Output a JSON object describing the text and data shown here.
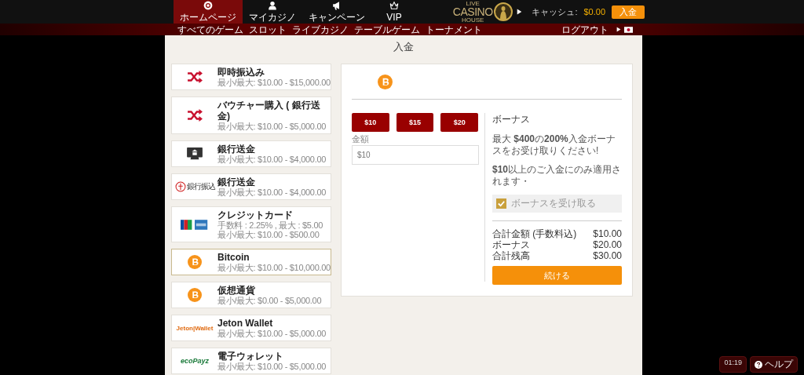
{
  "nav": {
    "tabs": [
      {
        "label": "ホームページ",
        "selected": true
      },
      {
        "label": "マイカジノ",
        "selected": false
      },
      {
        "label": "キャンペーン",
        "selected": false
      },
      {
        "label": "VIP",
        "selected": false
      }
    ],
    "logo": {
      "top": "LIVE",
      "main": "CASINO",
      "bottom": "HOUSE"
    },
    "cash": {
      "label": "キャッシュ:",
      "amount": "$0.00"
    },
    "deposit_button": "入金"
  },
  "subnav": {
    "links": [
      "すべてのゲーム",
      "スロット",
      "ライブカジノ",
      "テーブルゲーム",
      "トーナメント"
    ],
    "logout": "ログアウト"
  },
  "page_title": "入金",
  "methods": [
    {
      "kind": "shuffle",
      "name": "即時振込み",
      "lines": [
        "最小/最大: $10.00 - $15,000.00"
      ],
      "selected": false
    },
    {
      "kind": "shuffle",
      "name": "バウチャー購入 ( 銀行送金)",
      "lines": [
        "最小/最大: $10.00 - $5,000.00"
      ],
      "selected": false
    },
    {
      "kind": "bank",
      "name": "銀行送金",
      "lines": [
        "最小/最大: $10.00 - $4,000.00"
      ],
      "selected": false
    },
    {
      "kind": "bank-logo",
      "logo_text": "銀行振込",
      "name": "銀行送金",
      "lines": [
        "最小/最大: $10.00 - $4,000.00"
      ],
      "selected": false
    },
    {
      "kind": "cards",
      "name": "クレジットカード",
      "lines": [
        "手数料 : 2.25% , 最大 : $5.00",
        "最小/最大: $10.00 - $500.00"
      ],
      "selected": false
    },
    {
      "kind": "bitcoin",
      "name": "Bitcoin",
      "lines": [
        "最小/最大: $10.00 - $10,000.00"
      ],
      "selected": true
    },
    {
      "kind": "bitcoin",
      "name": "仮想通貨",
      "lines": [
        "最小/最大: $0.00 - $5,000.00"
      ],
      "selected": false
    },
    {
      "kind": "text-logo",
      "logo_text": "Jeton|Wallet",
      "name": "Jeton Wallet",
      "lines": [
        "最小/最大: $10.00 - $5,000.00"
      ],
      "selected": false
    },
    {
      "kind": "text-logo",
      "logo_text": "ecoPayz",
      "name": "電子ウォレット",
      "lines": [
        "最小/最大: $10.00 - $5,000.00"
      ],
      "selected": false
    }
  ],
  "panel": {
    "quick_amounts": [
      "$10",
      "$15",
      "$20"
    ],
    "amount": {
      "label": "金額",
      "placeholder": "$10"
    },
    "bonus": {
      "title": "ボーナス",
      "offer": "最大 **$400**の**200%**入金ボーナスをお受け取りください!",
      "condition": "**$10**以上のご入金にのみ適用されます・",
      "checkbox": {
        "label": "ボーナスを受け取る",
        "checked": true
      }
    },
    "summary": [
      {
        "label": "合計金額 (手数料込)",
        "value": "$10.00"
      },
      {
        "label": "ボーナス",
        "value": "$20.00"
      },
      {
        "label": "合計残高",
        "value": "$30.00"
      }
    ],
    "continue_button": "続ける"
  },
  "footer": {
    "timer": "01:19",
    "help": "ヘルプ"
  }
}
